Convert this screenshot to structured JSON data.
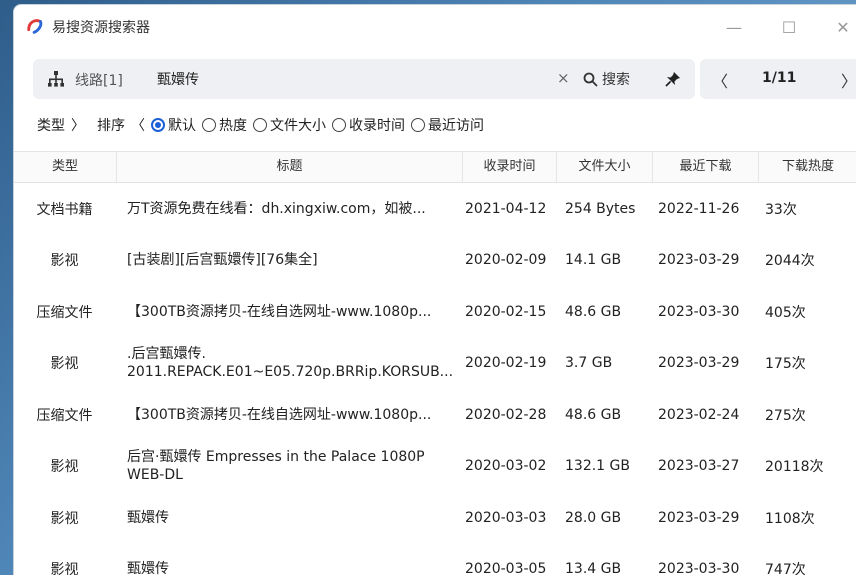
{
  "app": {
    "title": "易搜资源搜索器"
  },
  "window_controls": {
    "minimize": "—",
    "maximize": "☐",
    "close": "✕"
  },
  "search": {
    "route_label": "线路[1]",
    "query": "甄嬛传",
    "clear": "×",
    "button_label": "搜索"
  },
  "pager": {
    "prev": "〈",
    "text": "1/11",
    "next": "〉"
  },
  "filters": {
    "type_label": "类型",
    "type_arrow": "〉",
    "sort_label": "排序",
    "sort_arrow": "〈",
    "options": [
      "默认",
      "热度",
      "文件大小",
      "收录时间",
      "最近访问"
    ],
    "selected": "默认"
  },
  "table": {
    "headers": [
      "类型",
      "标题",
      "收录时间",
      "文件大小",
      "最近下载",
      "下载热度"
    ],
    "rows": [
      {
        "type": "文档书籍",
        "title": "万T资源免费在线看：dh.xingxiw.com，如被...",
        "time": "2021-04-12",
        "size": "254 Bytes",
        "last": "2022-11-26",
        "hot": "33次"
      },
      {
        "type": "影视",
        "title": "[古装剧][后宫甄嬛传][76集全]",
        "time": "2020-02-09",
        "size": "14.1 GB",
        "last": "2023-03-29",
        "hot": "2044次"
      },
      {
        "type": "压缩文件",
        "title": "【300TB资源拷贝-在线自选网址-www.1080p...",
        "time": "2020-02-15",
        "size": "48.6 GB",
        "last": "2023-03-30",
        "hot": "405次"
      },
      {
        "type": "影视",
        "title": ".后宫甄嬛传.\n2011.REPACK.E01~E05.720p.BRRip.KORSUB...",
        "time": "2020-02-19",
        "size": "3.7 GB",
        "last": "2023-03-29",
        "hot": "175次"
      },
      {
        "type": "压缩文件",
        "title": "【300TB资源拷贝-在线自选网址-www.1080p...",
        "time": "2020-02-28",
        "size": "48.6 GB",
        "last": "2023-02-24",
        "hot": "275次"
      },
      {
        "type": "影视",
        "title": "后宫·甄嬛传 Empresses in the Palace 1080P WEB-DL",
        "time": "2020-03-02",
        "size": "132.1 GB",
        "last": "2023-03-27",
        "hot": "20118次"
      },
      {
        "type": "影视",
        "title": "甄嬛传",
        "time": "2020-03-03",
        "size": "28.0 GB",
        "last": "2023-03-29",
        "hot": "1108次"
      },
      {
        "type": "影视",
        "title": "甄嬛传",
        "time": "2020-03-05",
        "size": "13.4 GB",
        "last": "2023-03-30",
        "hot": "747次"
      }
    ]
  },
  "colors": {
    "accent": "#1d5fd6",
    "panel": "#eef0f3"
  }
}
